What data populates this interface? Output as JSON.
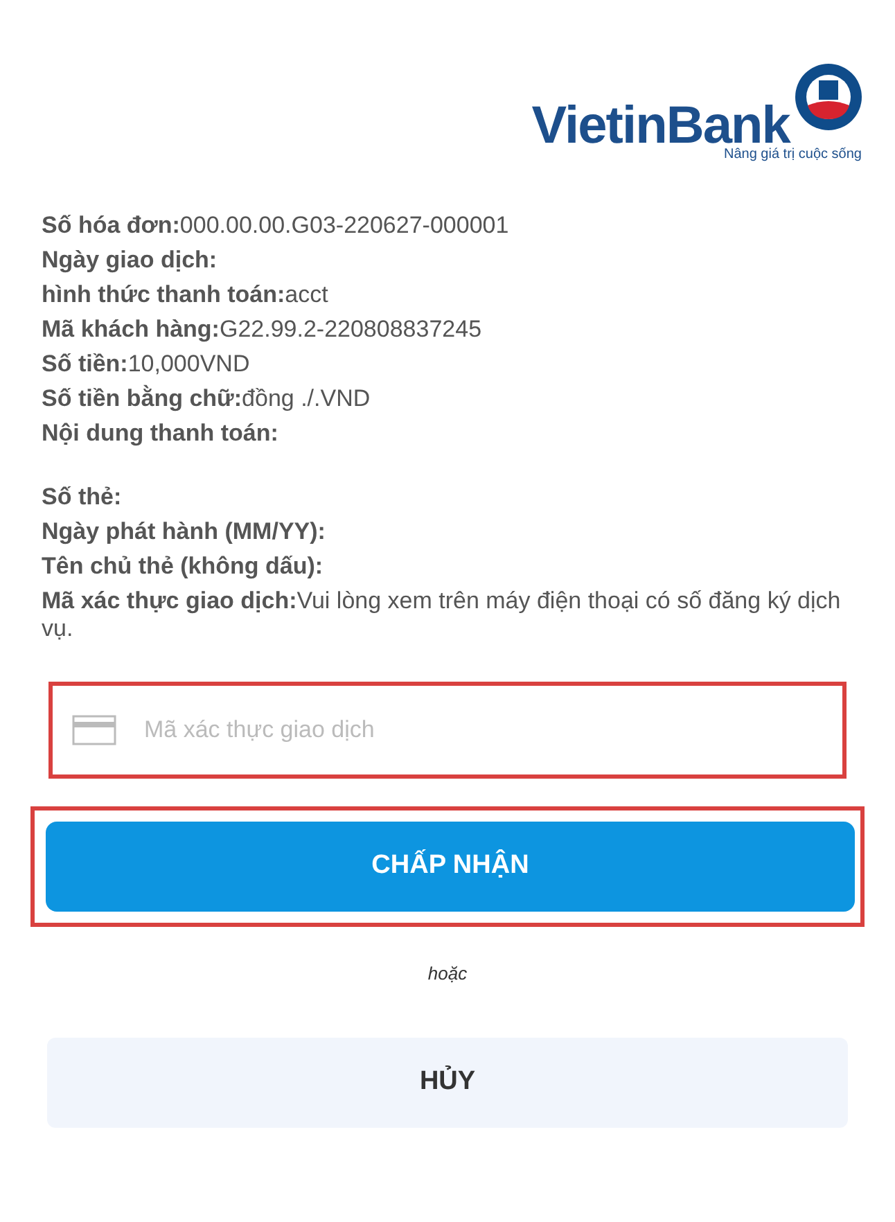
{
  "logo": {
    "name": "VietinBank",
    "tagline": "Nâng giá trị cuộc sống"
  },
  "details": [
    [
      "**Số hóa đơn:**000.00.00.G03-220627-000001",
      "**Ngày giao dịch:**",
      "**hình thức thanh toán:**acct",
      "**Mã khách hàng:**G22.99.2-220808837245",
      "**Số tiền:**10,000VND",
      "**Số tiền bằng chữ:**đồng ./.VND",
      "**Nội dung thanh toán:**"
    ],
    [
      "**Số thẻ:**",
      "**Ngày phát hành (MM/YY):**",
      "**Tên chủ thẻ (không dấu):**",
      "**Mã xác thực giao dịch:**Vui lòng xem trên máy điện thoại có số đăng ký dịch vụ."
    ]
  ],
  "otp_field": {
    "placeholder": "Mã xác thực giao dịch",
    "highlighted": true
  },
  "accept_button": {
    "label": "CHẤP NHẬN",
    "highlighted": true
  },
  "separator": "hoặc",
  "cancel_button": {
    "label": "HỦY"
  }
}
